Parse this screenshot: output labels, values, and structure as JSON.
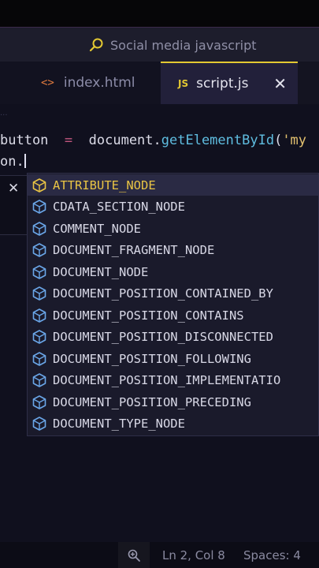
{
  "titlebar": {
    "search_text": "Social media javascript"
  },
  "tabs": [
    {
      "label": "index.html",
      "icon": "code-brackets-icon",
      "icon_glyph": "<>"
    },
    {
      "label": "script.js",
      "icon": "js-file-icon",
      "icon_glyph": "JS",
      "active": true
    }
  ],
  "tab_close": "✕",
  "editor": {
    "breadcrumb_dots": "...",
    "line1": {
      "var": "button",
      "op": "=",
      "obj": "document.",
      "fn": "getElementById",
      "paren": "(",
      "str": "'my"
    },
    "line2": {
      "text": "on."
    }
  },
  "widget_close": "✕",
  "suggestions": [
    "ATTRIBUTE_NODE",
    "CDATA_SECTION_NODE",
    "COMMENT_NODE",
    "DOCUMENT_FRAGMENT_NODE",
    "DOCUMENT_NODE",
    "DOCUMENT_POSITION_CONTAINED_BY",
    "DOCUMENT_POSITION_CONTAINS",
    "DOCUMENT_POSITION_DISCONNECTED",
    "DOCUMENT_POSITION_FOLLOWING",
    "DOCUMENT_POSITION_IMPLEMENTATIO",
    "DOCUMENT_POSITION_PRECEDING",
    "DOCUMENT_TYPE_NODE"
  ],
  "status": {
    "position": "Ln 2, Col 8",
    "spaces": "Spaces: 4"
  },
  "colors": {
    "accent": "#e3c832",
    "selected_text": "#e9c445",
    "function": "#5fbde0",
    "operator": "#c2577f",
    "string": "#e3c16f"
  }
}
